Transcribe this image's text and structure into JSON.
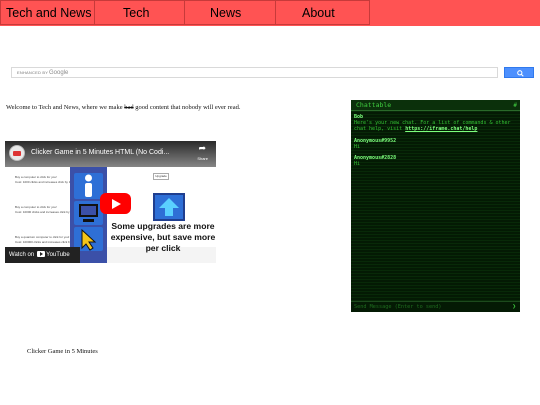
{
  "nav": {
    "brand": "Tech and News",
    "items": [
      "Tech",
      "News",
      "About"
    ]
  },
  "search": {
    "enhanced_label": "ENHANCED BY",
    "google_label": "Google"
  },
  "welcome": {
    "before": "Welcome to Tech and News, where we make ",
    "struck": "bad",
    "after": " good content that nobody will ever read."
  },
  "video": {
    "title": "Clicker Game in 5 Minutes HTML (No Codi...",
    "share_label": "Share",
    "caption": "Some upgrades are more expensive, but save more per click",
    "watch_on": "Watch on",
    "youtube": "YouTube",
    "mock_lines": [
      "Buy a computer to click for you!",
      "Cost: 1000 clicks and increases click by 1",
      "Buy a computer to click for you!",
      "Cost: 10000 clicks and increases click by 10",
      "Buy a quantum computer to click for you!",
      "Cost: 100000 clicks and increases click by 100"
    ],
    "mock_button": "Upgrade"
  },
  "video_caption": "Clicker Game in 5 Minutes",
  "chat": {
    "title": "Chattable",
    "hash": "#",
    "messages": [
      {
        "user": "Bob",
        "text": "Here's your new chat. For a list of commands & other chat help, visit ",
        "link": "https://iframe.chat/help"
      },
      {
        "user": "Anonymous#9952",
        "text": "Hi"
      },
      {
        "user": "Anonymous#2828",
        "text": "Hi"
      }
    ],
    "input_placeholder": "Send Message (Enter to send)",
    "send_icon": "send-arrow-icon"
  },
  "colors": {
    "nav_bg": "#ff5353",
    "chat_bg": "#041a04",
    "chat_text": "#34c234",
    "search_button": "#4d90fe"
  }
}
